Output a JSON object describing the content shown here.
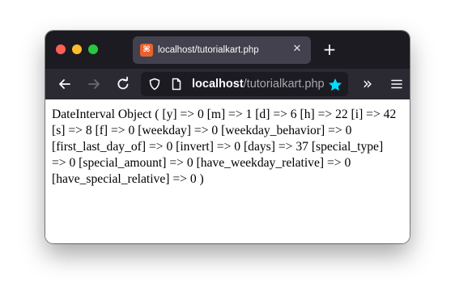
{
  "window": {
    "traffic_colors": {
      "close": "#ff5f57",
      "minimize": "#febc2e",
      "maximize": "#28c840"
    }
  },
  "tab": {
    "favicon_glyph": "⌘",
    "favicon_color": "#e9622e",
    "title": "localhost/tutorialkart.php",
    "close_glyph": "✕"
  },
  "new_tab_glyph": "+",
  "toolbar": {
    "back_icon": "arrow-left-icon",
    "forward_icon": "arrow-right-icon",
    "reload_icon": "reload-icon",
    "overflow_glyph": "»",
    "menu_icon": "hamburger-icon"
  },
  "urlbar": {
    "host": "localhost",
    "path": "/tutorialkart.php",
    "shield_icon": "shield-icon",
    "page_icon": "page-icon",
    "bookmark_icon": "star-icon",
    "bookmark_color": "#00ddff"
  },
  "page": {
    "output": "DateInterval Object ( [y] => 0 [m] => 1 [d] => 6 [h] => 22 [i] => 42 [s] => 8 [f] => 0 [weekday] => 0 [weekday_behavior] => 0 [first_last_day_of] => 0 [invert] => 0 [days] => 37 [special_type] => 0 [special_amount] => 0 [have_weekday_relative] => 0 [have_special_relative] => 0 )"
  }
}
